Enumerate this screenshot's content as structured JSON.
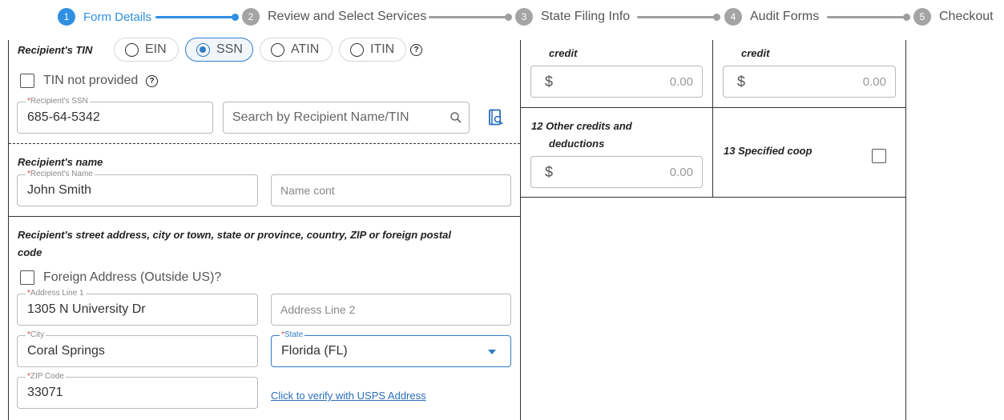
{
  "stepper": {
    "steps": [
      {
        "num": "1",
        "label": "Form Details"
      },
      {
        "num": "2",
        "label": "Review and Select Services"
      },
      {
        "num": "3",
        "label": "State Filing Info"
      },
      {
        "num": "4",
        "label": "Audit Forms"
      },
      {
        "num": "5",
        "label": "Checkout"
      }
    ],
    "active_color": "#2f8fe0",
    "inactive_color": "#a4a4a4"
  },
  "recipient_tin": {
    "label": "Recipient's TIN",
    "options": [
      "EIN",
      "SSN",
      "ATIN",
      "ITIN"
    ],
    "selected": "SSN",
    "help_icon": "question-circle-icon"
  },
  "tin_not_provided": {
    "label": "TIN not provided",
    "checked": false
  },
  "ssn_field": {
    "required_mark": "*",
    "legend": "Recipient's SSN",
    "value": "685-64-5342"
  },
  "search": {
    "placeholder": "Search by Recipient Name/TIN",
    "icon": "search-icon",
    "lookup_icon": "contact-book-search-icon"
  },
  "recipient_name": {
    "section_label": "Recipient's name",
    "required_mark": "*",
    "legend": "Recipient's Name",
    "value": "John Smith",
    "cont_placeholder": "Name cont"
  },
  "address": {
    "section_label_line1": "Recipient's street address, city or town, state or province, country, ZIP or foreign postal",
    "section_label_line2": "code",
    "foreign_label": "Foreign Address (Outside US)?",
    "foreign_checked": false,
    "line1_legend": "Address Line 1",
    "line1_value": "1305 N University Dr",
    "line2_placeholder": "Address Line 2",
    "city_legend": "City",
    "city_value": "Coral Springs",
    "state_legend": "State",
    "state_value": "Florida (FL)",
    "zip_legend": "ZIP Code",
    "zip_value": "33071",
    "required_mark": "*",
    "verify_link": "Click to verify with USPS Address"
  },
  "right": {
    "top_left_label": "credit",
    "top_right_label": "credit",
    "top_left_amount": "0.00",
    "top_right_amount": "0.00",
    "box12_label_line1": "12  Other credits and",
    "box12_label_line2": "deductions",
    "box12_amount": "0.00",
    "box13_label": "13  Specified coop",
    "box13_checked": false,
    "currency": "$"
  }
}
